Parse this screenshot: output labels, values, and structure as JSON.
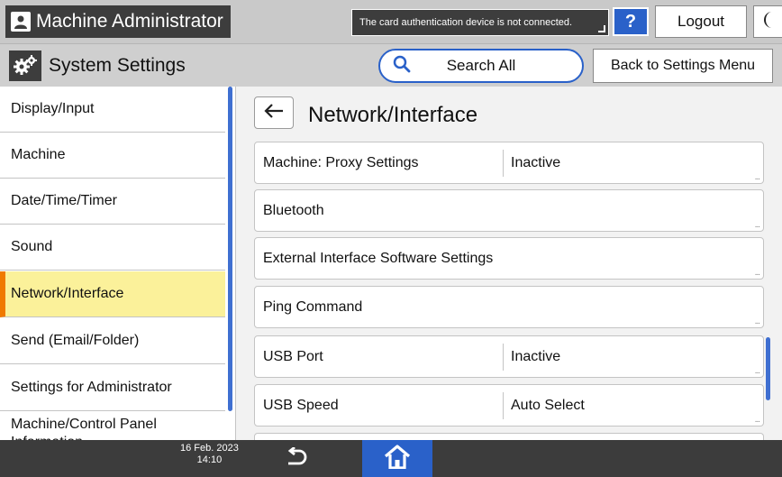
{
  "user": {
    "title": "Machine Administrator",
    "icon": "user-icon"
  },
  "notice": "The card authentication device is not connected.",
  "top_buttons": {
    "help_label": "?",
    "logout_label": "Logout"
  },
  "header": {
    "title": "System Settings",
    "search_label": "Search All",
    "back_label": "Back to Settings Menu"
  },
  "sidebar": {
    "items": [
      {
        "label": "Display/Input",
        "active": false
      },
      {
        "label": "Machine",
        "active": false
      },
      {
        "label": "Date/Time/Timer",
        "active": false
      },
      {
        "label": "Sound",
        "active": false
      },
      {
        "label": "Network/Interface",
        "active": true
      },
      {
        "label": "Send (Email/Folder)",
        "active": false
      },
      {
        "label": "Settings for Administrator",
        "active": false
      },
      {
        "label": "Machine/Control Panel Information",
        "active": false
      }
    ]
  },
  "main": {
    "title": "Network/Interface",
    "rows": [
      {
        "label": "Machine: Proxy Settings",
        "value": "Inactive"
      },
      {
        "label": "Bluetooth",
        "value": ""
      },
      {
        "label": "External Interface Software Settings",
        "value": ""
      },
      {
        "label": "Ping Command",
        "value": ""
      },
      {
        "label": "USB Port",
        "value": "Inactive"
      },
      {
        "label": "USB Speed",
        "value": "Auto Select"
      }
    ],
    "row_more": "..."
  },
  "footer": {
    "date": "16 Feb. 2023",
    "time": "14:10"
  },
  "colors": {
    "accent_blue": "#2a61c9",
    "active_bg": "#fbf19a",
    "active_bar": "#f07a00",
    "dark_bar": "#3c3c3c"
  }
}
